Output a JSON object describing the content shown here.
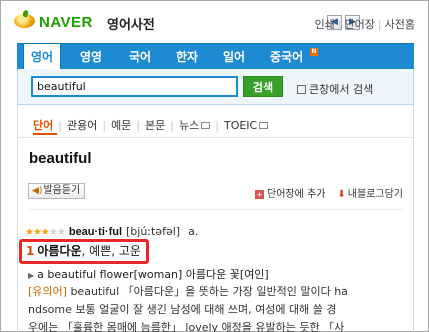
{
  "header": {
    "brand": "NAVER",
    "product": "영어사전",
    "back_arrow": "◀",
    "forward_arrow": "▶",
    "links": [
      "인쇄",
      "단어장",
      "사전홈"
    ]
  },
  "tabs": [
    {
      "label": "영어",
      "active": true
    },
    {
      "label": "영영"
    },
    {
      "label": "국어"
    },
    {
      "label": "한자"
    },
    {
      "label": "일어"
    },
    {
      "label": "중국어",
      "badge": "N"
    }
  ],
  "search": {
    "value": "beautiful",
    "button_label": "검색",
    "bigwin_label": "큰창에서 검색"
  },
  "subtabs": [
    "단어",
    "관용어",
    "예문",
    "본문",
    "뉴스",
    "TOEIC"
  ],
  "entry": {
    "headword": "beautiful",
    "listen_label": "발음듣기",
    "add_wordbook_label": "단어장에 추가",
    "blog_label": "내블로그담기",
    "stars_filled": 3,
    "stars_total": 5,
    "syllabified": "beau·ti·ful",
    "pronunciation": "[bjúːtəfəl]",
    "pos": "a.",
    "sense_number": "1",
    "sense_primary": "아름다운",
    "sense_rest": ", 예쁜, 고운",
    "example": "a beautiful flower[woman] 아름다운 꽃[여인]",
    "synonym_tag": "[유의어]",
    "synonym_lines": [
      " beautiful 「아름다운」을 뜻하는 가장 일반적인 말이다 ha",
      "ndsome 보통 얼굴이 잘 생긴 남성에 대해 쓰며, 여성에 대해 쓸 경",
      "우에는 「훌륭한 몸매에 늠름한」 lovely 애정을 유발하는 듯한 「사"
    ]
  }
}
